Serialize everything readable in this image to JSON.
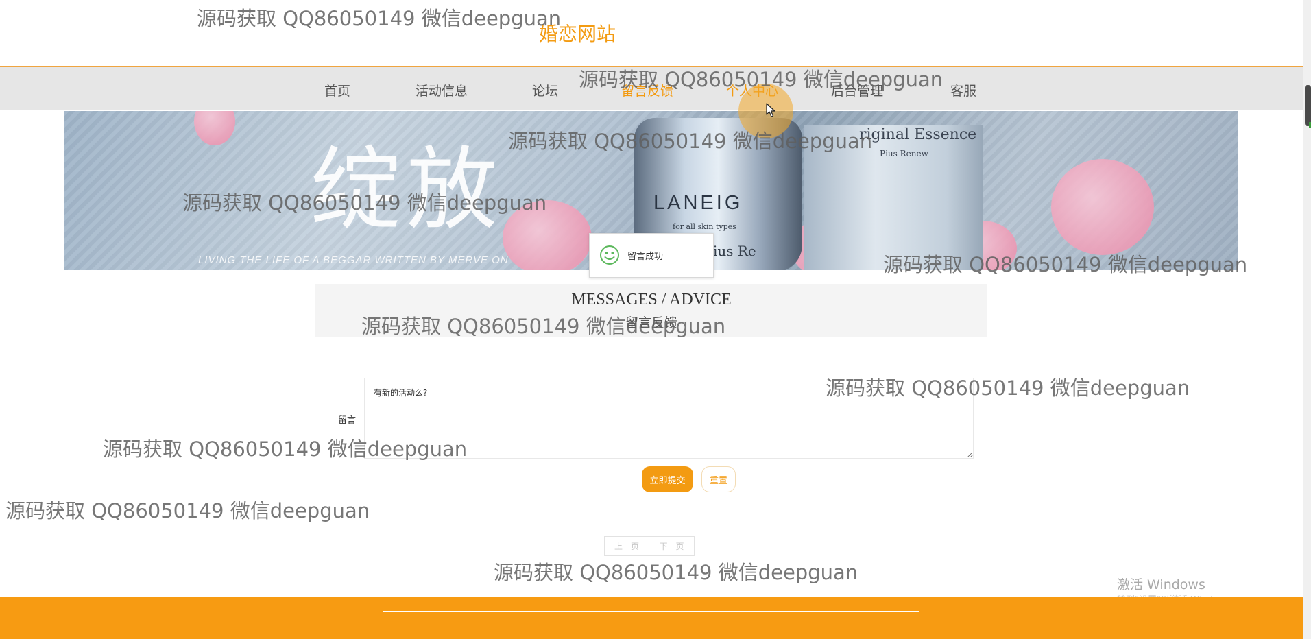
{
  "site": {
    "title": "婚恋网站"
  },
  "nav": {
    "items": [
      {
        "label": "首页",
        "active": false
      },
      {
        "label": "活动信息",
        "active": false
      },
      {
        "label": "论坛",
        "active": false
      },
      {
        "label": "留言反馈",
        "active": true
      },
      {
        "label": "个人中心",
        "active": true
      },
      {
        "label": "后台管理",
        "active": false
      },
      {
        "label": "客服",
        "active": false
      }
    ]
  },
  "banner": {
    "big_text": "绽放",
    "small_text": "LIVING THE LIFE OF A BEGGAR WRITTEN BY MERVE ON",
    "jar_label": "LANEIG",
    "jar_sub": "hite Pius Re",
    "jar_sub2": "for all skin types",
    "bottle_title": "riginal Essence",
    "bottle_sub": "Pius Renew"
  },
  "toast": {
    "text": "留言成功",
    "icon": "smile-icon"
  },
  "section": {
    "title_en": "MESSAGES / ADVICE",
    "title_cn": "留言反馈"
  },
  "form": {
    "label": "留言",
    "value": "有新的活动么?",
    "submit_label": "立即提交",
    "reset_label": "重置"
  },
  "pager": {
    "prev": "上一页",
    "next": "下一页"
  },
  "windows": {
    "activate": "激活 Windows",
    "activate_sub": "转到\"设置\"以激活 Windows。"
  },
  "watermark": {
    "text": "源码获取 QQ86050149 微信deepguan"
  },
  "colors": {
    "accent": "#f39b12",
    "footer": "#f79b12",
    "nav_bg": "#e6e6e6"
  }
}
